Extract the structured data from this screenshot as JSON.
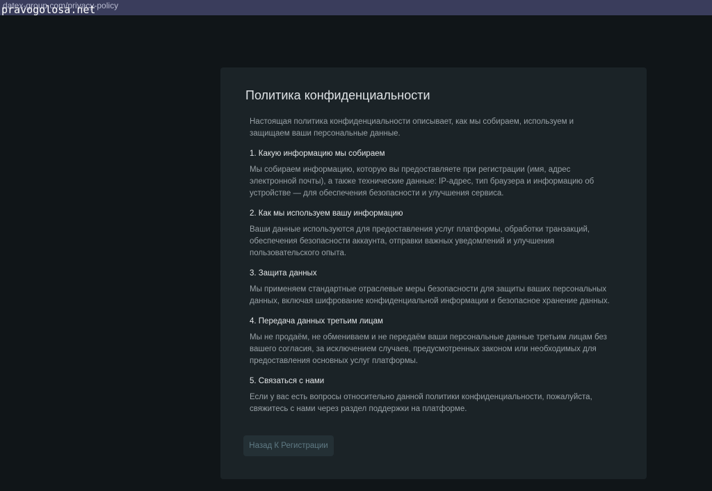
{
  "browser": {
    "url": "datex-group.com/privacy-policy",
    "watermark": "pravogolosa.net"
  },
  "page": {
    "title": "Политика конфиденциальности",
    "intro": "Настоящая политика конфиденциальности описывает, как мы собираем, используем и защищаем ваши персональные данные.",
    "sections": [
      {
        "heading": "1. Какую информацию мы собираем",
        "body": "Мы собираем информацию, которую вы предоставляете при регистрации (имя, адрес электронной почты), а также технические данные: IP-адрес, тип браузера и информацию об устройстве — для обеспечения безопасности и улучшения сервиса."
      },
      {
        "heading": "2. Как мы используем вашу информацию",
        "body": "Ваши данные используются для предоставления услуг платформы, обработки транзакций, обеспечения безопасности аккаунта, отправки важных уведомлений и улучшения пользовательского опыта."
      },
      {
        "heading": "3. Защита данных",
        "body": "Мы применяем стандартные отраслевые меры безопасности для защиты ваших персональных данных, включая шифрование конфиденциальной информации и безопасное хранение данных."
      },
      {
        "heading": "4. Передача данных третьим лицам",
        "body": "Мы не продаём, не обмениваем и не передаём ваши персональные данные третьим лицам без вашего согласия, за исключением случаев, предусмотренных законом или необходимых для предоставления основных услуг платформы."
      },
      {
        "heading": "5. Связаться с нами",
        "body": "Если у вас есть вопросы относительно данной политики конфиденциальности, пожалуйста, свяжитесь с нами через раздел поддержки на платформе."
      }
    ],
    "back_button_label": "Назад К Регистрации"
  },
  "colors": {
    "background": "#101518",
    "card": "#1b2327",
    "topbar": "#3a3d5c",
    "button": "#243035"
  }
}
